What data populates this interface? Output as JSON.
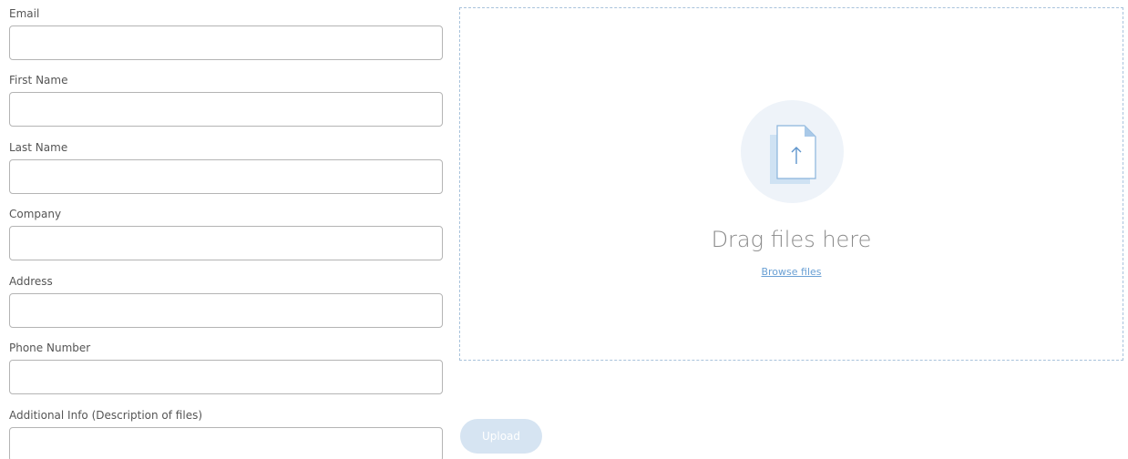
{
  "form": {
    "fields": [
      {
        "label": "Email",
        "value": "",
        "placeholder": ""
      },
      {
        "label": "First Name",
        "value": "",
        "placeholder": ""
      },
      {
        "label": "Last Name",
        "value": "",
        "placeholder": ""
      },
      {
        "label": "Company",
        "value": "",
        "placeholder": ""
      },
      {
        "label": "Address",
        "value": "",
        "placeholder": ""
      },
      {
        "label": "Phone Number",
        "value": "",
        "placeholder": ""
      },
      {
        "label": "Additional Info (Description of files)",
        "value": "",
        "placeholder": ""
      }
    ]
  },
  "dropzone": {
    "icon": "file-upload-icon",
    "title": "Drag files here",
    "browse_label": "Browse files"
  },
  "upload_button": {
    "label": "Upload",
    "state": "disabled"
  },
  "colors": {
    "input_border": "#b4b4b4",
    "dropzone_border": "#a9c3dc",
    "link": "#6aa0d4",
    "button_disabled": "#d6e4f2",
    "icon_circle": "#eef3f9"
  }
}
